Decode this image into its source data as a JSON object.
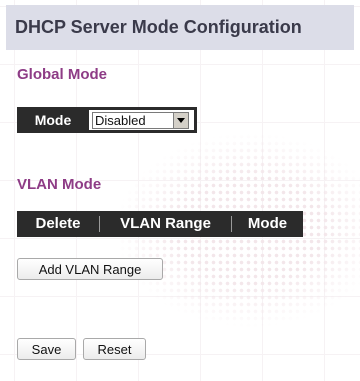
{
  "page": {
    "title": "DHCP Server Mode Configuration"
  },
  "global_mode": {
    "section_title": "Global Mode",
    "mode_label": "Mode",
    "mode_value": "Disabled"
  },
  "vlan_mode": {
    "section_title": "VLAN Mode",
    "columns": [
      "Delete",
      "VLAN Range",
      "Mode"
    ],
    "add_button_label": "Add VLAN Range"
  },
  "actions": {
    "save_label": "Save",
    "reset_label": "Reset"
  },
  "colors": {
    "title_bar_bg": "#dcdde8",
    "section_title": "#8e3c86",
    "header_bg": "#2b2b2b"
  }
}
